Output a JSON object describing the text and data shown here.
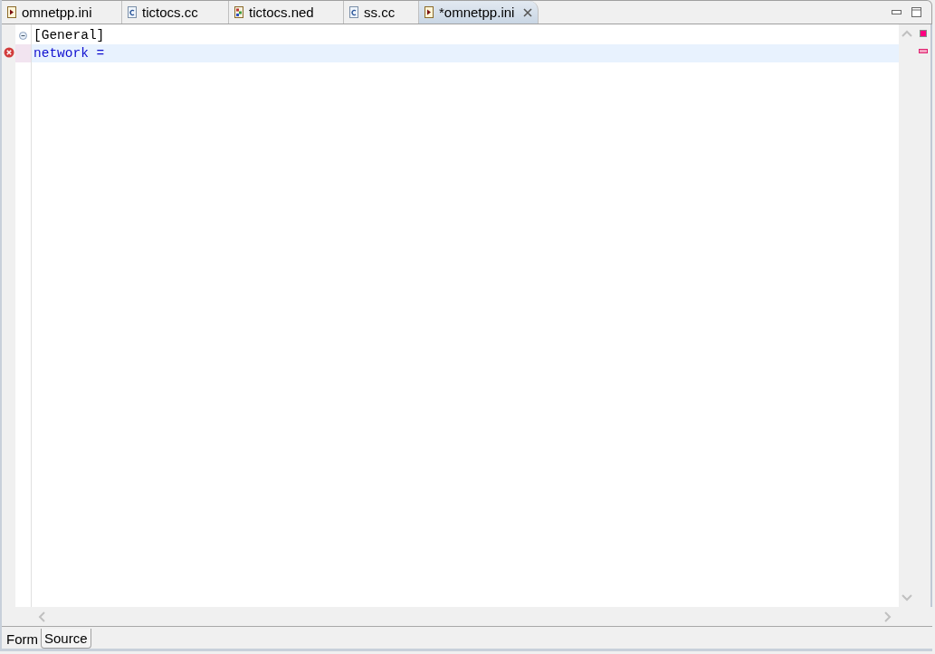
{
  "editor_tabs": [
    {
      "label": "omnetpp.ini",
      "kind": "ini",
      "selected": false
    },
    {
      "label": "tictocs.cc",
      "kind": "c",
      "selected": false
    },
    {
      "label": "tictocs.ned",
      "kind": "ned",
      "selected": false
    },
    {
      "label": "ss.cc",
      "kind": "c",
      "selected": false
    },
    {
      "label": "*omnetpp.ini",
      "kind": "ini",
      "selected": true
    }
  ],
  "lines": [
    {
      "kind": "section",
      "text": "[General]",
      "error": false,
      "current": false
    },
    {
      "kind": "key",
      "text": "network =",
      "error": true,
      "current": true
    }
  ],
  "bottom_tabs": [
    {
      "label": "Form",
      "selected": false
    },
    {
      "label": "Source",
      "selected": true
    }
  ]
}
